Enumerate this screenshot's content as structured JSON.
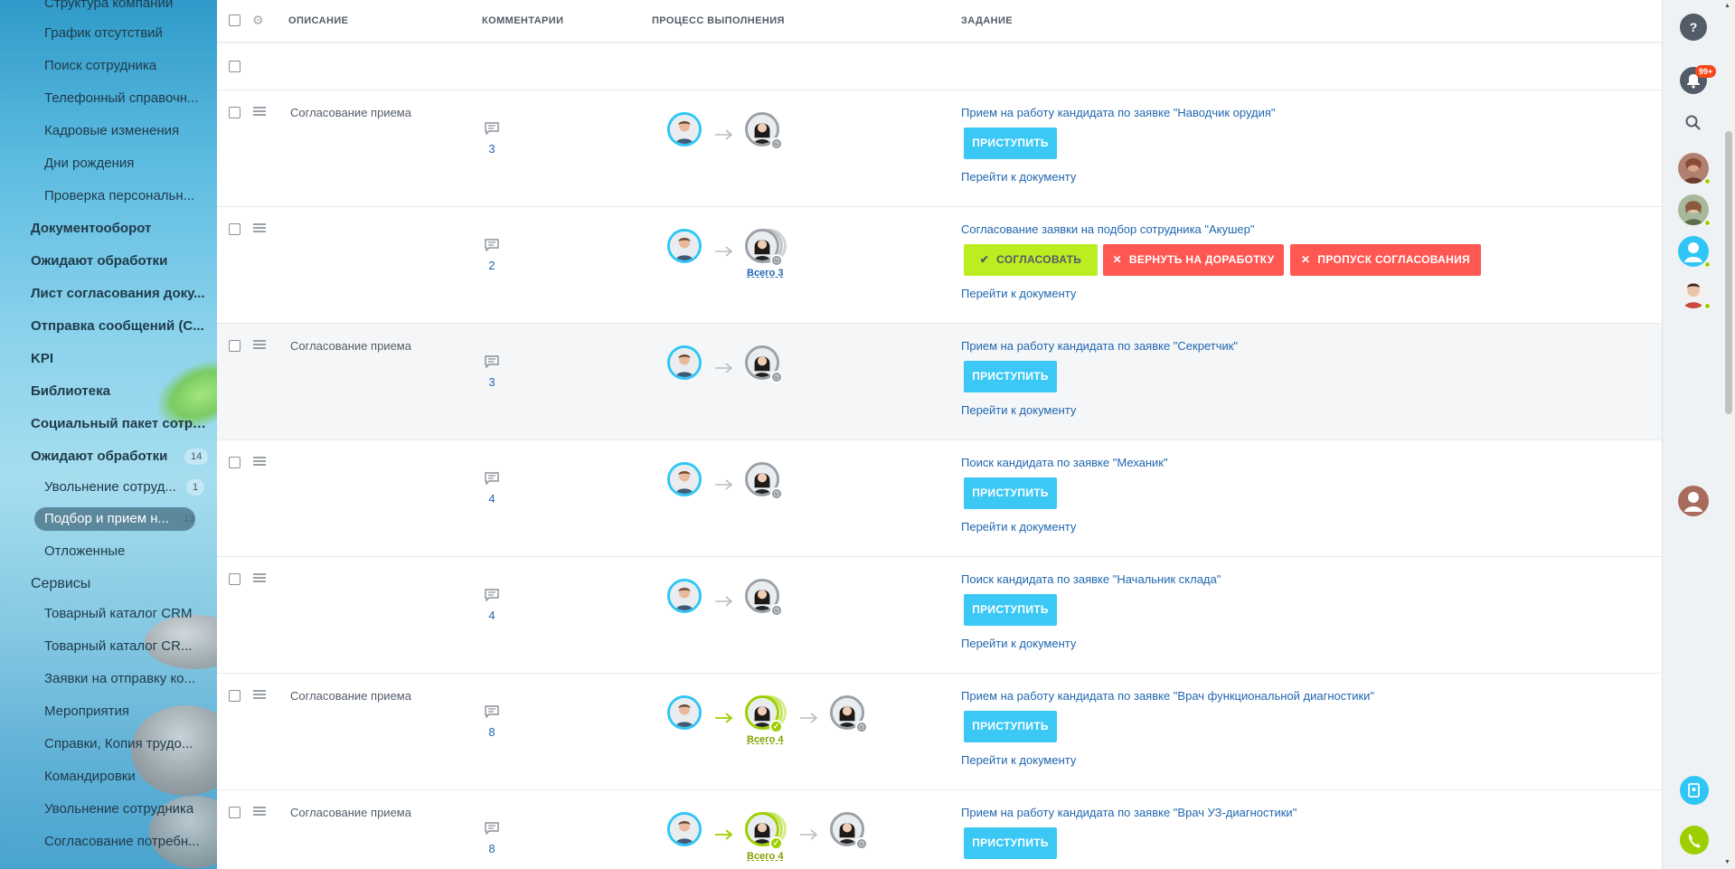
{
  "sidebar": {
    "items": [
      {
        "label": "Структура компании",
        "level": "sub"
      },
      {
        "label": "График отсутствий",
        "level": "sub"
      },
      {
        "label": "Поиск сотрудника",
        "level": "sub"
      },
      {
        "label": "Телефонный справочн...",
        "level": "sub"
      },
      {
        "label": "Кадровые изменения",
        "level": "sub"
      },
      {
        "label": "Дни рождения",
        "level": "sub"
      },
      {
        "label": "Проверка персональн...",
        "level": "sub"
      },
      {
        "label": "Документооборот",
        "level": "top"
      },
      {
        "label": "Ожидают обработки",
        "level": "top"
      },
      {
        "label": "Лист согласования доку...",
        "level": "top"
      },
      {
        "label": "Отправка сообщений (С...",
        "level": "top"
      },
      {
        "label": "KPI",
        "level": "top"
      },
      {
        "label": "Библиотека",
        "level": "top"
      },
      {
        "label": "Социальный пакет сотру...",
        "level": "top"
      },
      {
        "label": "Ожидают обработки",
        "level": "top",
        "count": "14"
      },
      {
        "label": "Увольнение сотруд...",
        "level": "sub",
        "count": "1"
      },
      {
        "label": "Подбор и прием н...",
        "level": "sub",
        "count": "13",
        "active": true
      },
      {
        "label": "Отложенные",
        "level": "sub"
      },
      {
        "label": "Сервисы",
        "level": "top"
      },
      {
        "label": "Товарный каталог CRM",
        "level": "sub"
      },
      {
        "label": "Товарный каталог CR...",
        "level": "sub"
      },
      {
        "label": "Заявки на отправку ко...",
        "level": "sub"
      },
      {
        "label": "Мероприятия",
        "level": "sub"
      },
      {
        "label": "Справки, Копия трудо...",
        "level": "sub"
      },
      {
        "label": "Командировки",
        "level": "sub"
      },
      {
        "label": "Увольнение сотрудника",
        "level": "sub"
      },
      {
        "label": "Согласование потребн...",
        "level": "sub"
      }
    ]
  },
  "header": {
    "col_description": "ОПИСАНИЕ",
    "col_comments": "КОММЕНТАРИИ",
    "col_process": "ПРОЦЕСС ВЫПОЛНЕНИЯ",
    "col_task": "ЗАДАНИЕ"
  },
  "rows": [
    {
      "description": "Согласование приема",
      "comments": "3",
      "task": "Прием на работу кандидата по заявке \"Наводчик орудия\"",
      "action": "ПРИСТУПИТЬ",
      "doc_link": "Перейти к документу"
    },
    {
      "description": "",
      "comments": "2",
      "task": "Согласование заявки на подбор сотрудника \"Акушер\"",
      "approve": "СОГЛАСОВАТЬ",
      "return": "ВЕРНУТЬ НА ДОРАБОТКУ",
      "skip": "ПРОПУСК СОГЛАСОВАНИЯ",
      "total": "Всего 3",
      "doc_link": "Перейти к документу"
    },
    {
      "description": "Согласование приема",
      "comments": "3",
      "task": "Прием на работу кандидата по заявке \"Секретчик\"",
      "action": "ПРИСТУПИТЬ",
      "doc_link": "Перейти к документу"
    },
    {
      "description": "",
      "comments": "4",
      "task": "Поиск кандидата по заявке \"Механик\"",
      "action": "ПРИСТУПИТЬ",
      "doc_link": "Перейти к документу"
    },
    {
      "description": "",
      "comments": "4",
      "task": "Поиск кандидата по заявке \"Начальник склада\"",
      "action": "ПРИСТУПИТЬ",
      "doc_link": "Перейти к документу"
    },
    {
      "description": "Согласование приема",
      "comments": "8",
      "task": "Прием на работу кандидата по заявке \"Врач функциональной диагностики\"",
      "action": "ПРИСТУПИТЬ",
      "total": "Всего 4",
      "doc_link": "Перейти к документу"
    },
    {
      "description": "Согласование приема",
      "comments": "8",
      "task": "Прием на работу кандидата по заявке \"Врач УЗ-диагностики\"",
      "action": "ПРИСТУПИТЬ",
      "total": "Всего 4"
    }
  ],
  "right_panel": {
    "help": "?",
    "notifications_badge": "99+"
  },
  "colors": {
    "accent_blue": "#2fc6f6",
    "link": "#2067b0",
    "approve": "#bbed21",
    "danger": "#ff5752",
    "done_green": "#9dcf00"
  }
}
